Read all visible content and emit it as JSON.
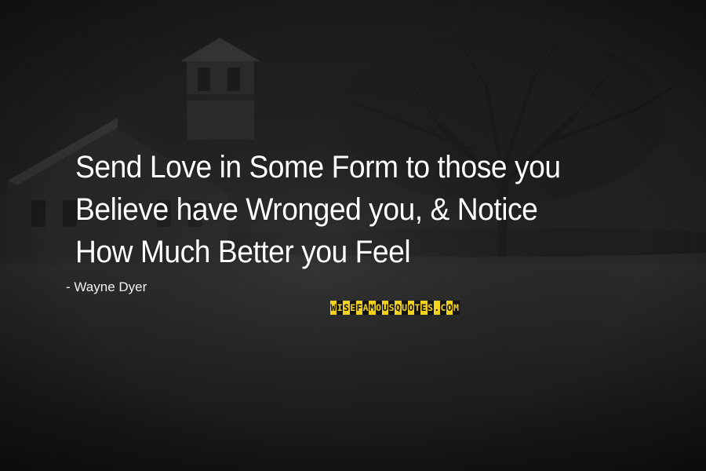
{
  "quote": {
    "lines": [
      "Send Love in Some Form to those you",
      "Believe have Wronged you, & Notice",
      "How Much Better you Feel"
    ],
    "author": "- Wayne Dyer"
  },
  "watermark": {
    "text": "WISEFAMOUSQUOTES.COM",
    "colors": [
      "#f2d21c",
      "#151515"
    ]
  },
  "scene": {
    "subjects": [
      "church-building",
      "bell-tower",
      "bare-tree",
      "field"
    ],
    "tone": "dark grayscale"
  }
}
